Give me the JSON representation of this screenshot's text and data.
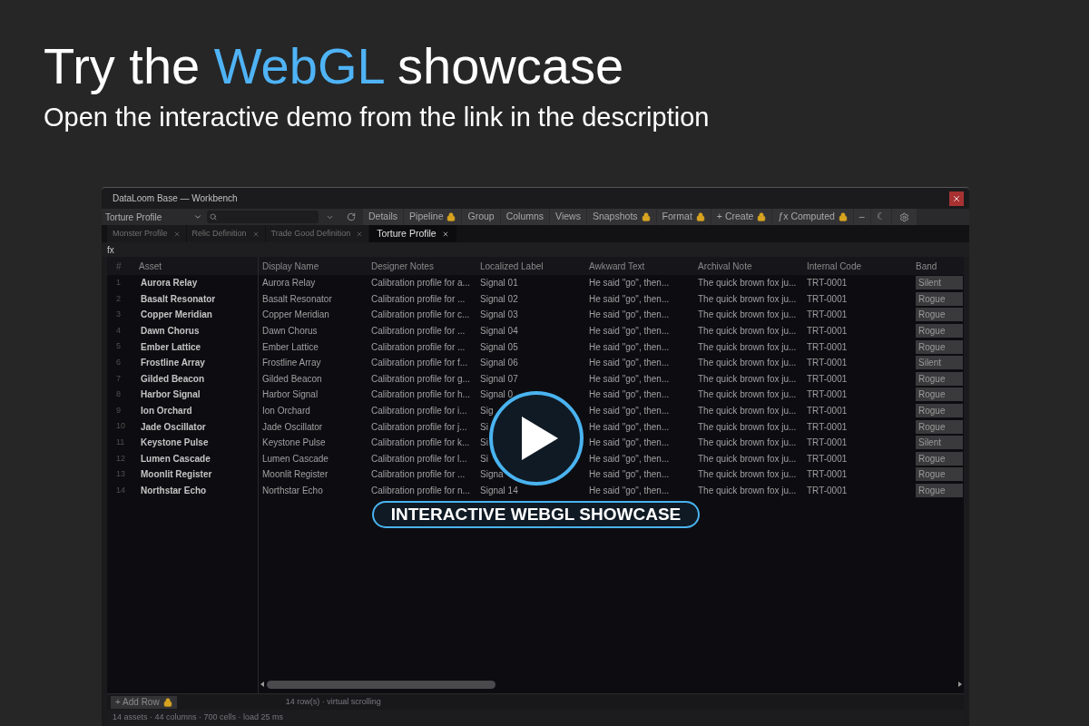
{
  "headline": {
    "before": "Try the",
    "highlight": "WebGL",
    "after": "showcase"
  },
  "subtitle": "Open the interactive demo from the link in the description",
  "window": {
    "title": "DataLoom Base — Workbench"
  },
  "toolbar": {
    "profile": "Torture Profile",
    "buttons": [
      {
        "label": "Details",
        "locked": false
      },
      {
        "label": "Pipeline",
        "locked": true
      },
      {
        "label": "Group",
        "locked": false
      },
      {
        "label": "Columns",
        "locked": false
      },
      {
        "label": "Views",
        "locked": false
      },
      {
        "label": "Snapshots",
        "locked": true
      },
      {
        "label": "Format",
        "locked": true
      },
      {
        "label": "+ Create",
        "locked": true
      },
      {
        "label": "ƒx Computed",
        "locked": true
      },
      {
        "label": "–",
        "locked": false
      },
      {
        "label": "☾",
        "locked": false
      }
    ]
  },
  "tabs": [
    {
      "label": "Monster Profile",
      "selected": false
    },
    {
      "label": "Relic Definition",
      "selected": false
    },
    {
      "label": "Trade Good Definition",
      "selected": false
    },
    {
      "label": "Torture Profile",
      "selected": true
    }
  ],
  "formula_bar": {
    "label": "fx"
  },
  "table": {
    "columns": [
      "#",
      "Asset",
      "Display Name",
      "Designer Notes",
      "Localized Label",
      "Awkward Text",
      "Archival Note",
      "Internal Code",
      "Band"
    ],
    "rows": [
      [
        "1",
        "Aurora Relay",
        "Aurora Relay",
        "Calibration profile for a...",
        "Signal 01",
        "He said \"go\", then...",
        "The quick brown fox ju...",
        "TRT-0001",
        "Silent"
      ],
      [
        "2",
        "Basalt Resonator",
        "Basalt Resonator",
        "Calibration profile for ...",
        "Signal 02",
        "He said \"go\", then...",
        "The quick brown fox ju...",
        "TRT-0001",
        "Rogue"
      ],
      [
        "3",
        "Copper Meridian",
        "Copper Meridian",
        "Calibration profile for c...",
        "Signal 03",
        "He said \"go\", then...",
        "The quick brown fox ju...",
        "TRT-0001",
        "Rogue"
      ],
      [
        "4",
        "Dawn Chorus",
        "Dawn Chorus",
        "Calibration profile for ...",
        "Signal 04",
        "He said \"go\", then...",
        "The quick brown fox ju...",
        "TRT-0001",
        "Rogue"
      ],
      [
        "5",
        "Ember Lattice",
        "Ember Lattice",
        "Calibration profile for ...",
        "Signal 05",
        "He said \"go\", then...",
        "The quick brown fox ju...",
        "TRT-0001",
        "Rogue"
      ],
      [
        "6",
        "Frostline Array",
        "Frostline Array",
        "Calibration profile for f...",
        "Signal 06",
        "He said \"go\", then...",
        "The quick brown fox ju...",
        "TRT-0001",
        "Silent"
      ],
      [
        "7",
        "Gilded Beacon",
        "Gilded Beacon",
        "Calibration profile for g...",
        "Signal 07",
        "He said \"go\", then...",
        "The quick brown fox ju...",
        "TRT-0001",
        "Rogue"
      ],
      [
        "8",
        "Harbor Signal",
        "Harbor Signal",
        "Calibration profile for h...",
        "Signal 0",
        "He said \"go\", then...",
        "The quick brown fox ju...",
        "TRT-0001",
        "Rogue"
      ],
      [
        "9",
        "Ion Orchard",
        "Ion Orchard",
        "Calibration profile for i...",
        "Sig",
        "He said \"go\", then...",
        "The quick brown fox ju...",
        "TRT-0001",
        "Rogue"
      ],
      [
        "10",
        "Jade Oscillator",
        "Jade Oscillator",
        "Calibration profile for j...",
        "Si",
        "He said \"go\", then...",
        "The quick brown fox ju...",
        "TRT-0001",
        "Rogue"
      ],
      [
        "11",
        "Keystone Pulse",
        "Keystone Pulse",
        "Calibration profile for k...",
        "Si",
        "He said \"go\", then...",
        "The quick brown fox ju...",
        "TRT-0001",
        "Silent"
      ],
      [
        "12",
        "Lumen Cascade",
        "Lumen Cascade",
        "Calibration profile for l...",
        "Si",
        "He said \"go\", then...",
        "The quick brown fox ju...",
        "TRT-0001",
        "Rogue"
      ],
      [
        "13",
        "Moonlit Register",
        "Moonlit Register",
        "Calibration profile for ...",
        "Signa",
        "He said \"go\", then...",
        "The quick brown fox ju...",
        "TRT-0001",
        "Rogue"
      ],
      [
        "14",
        "Northstar Echo",
        "Northstar Echo",
        "Calibration profile for n...",
        "Signal 14",
        "He said \"go\", then...",
        "The quick brown fox ju...",
        "TRT-0001",
        "Rogue"
      ]
    ]
  },
  "footer": {
    "add_row": {
      "label": "+ Add Row",
      "locked": true
    },
    "row_info": "14 row(s) · virtual scrolling",
    "status": "14 assets · 44 columns · 700 cells · load 25 ms"
  },
  "overlay": {
    "badge": "INTERACTIVE WEBGL SHOWCASE"
  }
}
